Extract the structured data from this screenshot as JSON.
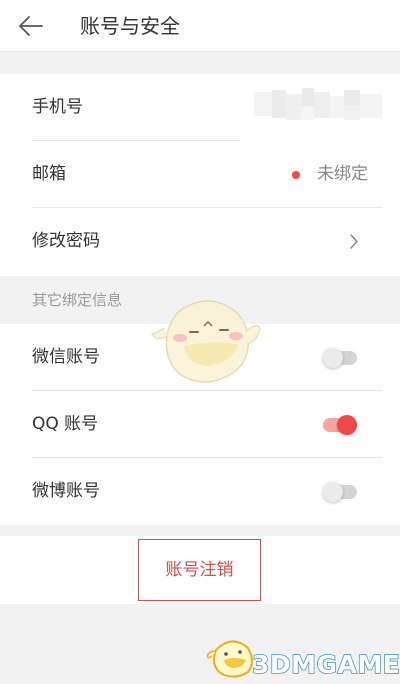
{
  "header": {
    "title": "账号与安全",
    "back_icon": "arrow-left-icon"
  },
  "account": {
    "rows": [
      {
        "label": "手机号",
        "value_masked": true
      },
      {
        "label": "邮箱",
        "status": "未绑定",
        "status_dot_color": "#f04848"
      },
      {
        "label": "修改密码",
        "icon": "chevron-right-icon"
      }
    ]
  },
  "bindings": {
    "section_title": "其它绑定信息",
    "rows": [
      {
        "label": "微信账号",
        "enabled": false
      },
      {
        "label": "QQ 账号",
        "enabled": true
      },
      {
        "label": "微博账号",
        "enabled": false
      }
    ]
  },
  "cancel": {
    "label": "账号注销",
    "color": "#e24848"
  },
  "watermark": {
    "text": "3DMGAME"
  },
  "colors": {
    "accent": "#f04848",
    "background": "#f2f2f2"
  }
}
